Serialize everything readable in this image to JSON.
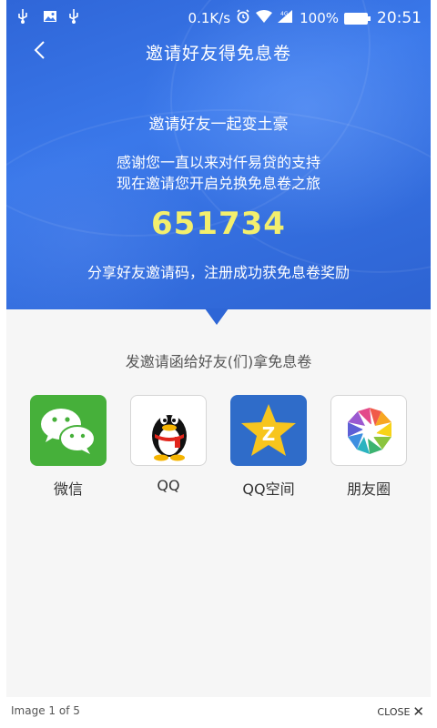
{
  "status_bar": {
    "net_speed": "0.1K/s",
    "battery": "100%",
    "time": "20:51",
    "icons": [
      "usb-icon",
      "image-icon",
      "usb-icon",
      "alarm-icon",
      "wifi-icon",
      "signal-icon",
      "battery-icon"
    ]
  },
  "nav": {
    "title": "邀请好友得免息卷",
    "back_icon": "back-chevron-icon"
  },
  "hero": {
    "headline": "邀请好友一起变土豪",
    "line1": "感谢您一直以来对仟易贷的支持",
    "line2": "现在邀请您开启兑换免息卷之旅",
    "invite_code": "651734",
    "note": "分享好友邀请码，注册成功获免息卷奖励"
  },
  "share": {
    "title": "发邀请函给好友(们)拿免息卷",
    "items": [
      {
        "label": "微信",
        "icon": "wechat-icon"
      },
      {
        "label": "QQ",
        "icon": "qq-icon"
      },
      {
        "label": "QQ空间",
        "icon": "qzone-icon"
      },
      {
        "label": "朋友圈",
        "icon": "moments-icon"
      }
    ]
  },
  "viewer": {
    "image_counter": "Image 1 of 5",
    "close_label": "CLOSE"
  },
  "colors": {
    "hero_blue": "#2f66d8",
    "code_yellow": "#f3ef6d",
    "wechat_green": "#46b03a",
    "qzone_blue": "#2f6cc9"
  }
}
